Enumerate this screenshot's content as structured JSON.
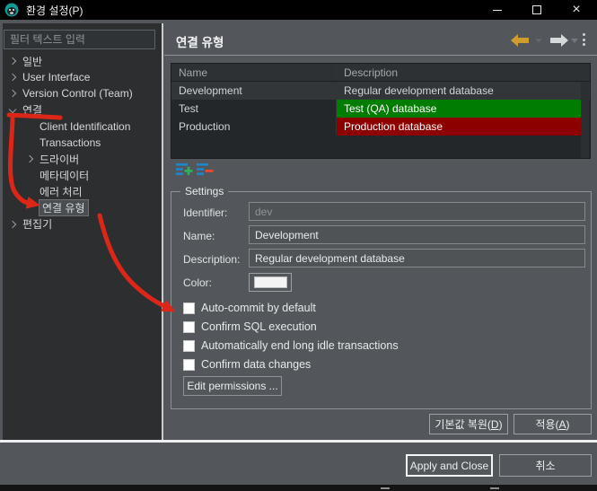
{
  "window": {
    "title": "환경 설정(P)"
  },
  "sidebar": {
    "filter_placeholder": "필터 텍스트 입력",
    "tree": [
      {
        "label": "일반"
      },
      {
        "label": "User Interface"
      },
      {
        "label": "Version Control (Team)"
      },
      {
        "label": "연결"
      },
      {
        "label": "Client Identification"
      },
      {
        "label": "Transactions"
      },
      {
        "label": "드라이버"
      },
      {
        "label": "메타데이터"
      },
      {
        "label": "에러 처리"
      },
      {
        "label": "연결 유형"
      },
      {
        "label": "편집기"
      }
    ]
  },
  "main": {
    "title": "연결 유형",
    "table": {
      "columns": [
        "Name",
        "Description"
      ],
      "rows": [
        {
          "name": "Development",
          "description": "Regular development database",
          "desc_bg": ""
        },
        {
          "name": "Test",
          "description": "Test (QA) database",
          "desc_bg": "#007C00"
        },
        {
          "name": "Production",
          "description": "Production database",
          "desc_bg": "#8D0000"
        }
      ]
    },
    "settings": {
      "legend": "Settings",
      "fields": {
        "identifier_label": "Identifier:",
        "identifier_value": "dev",
        "name_label": "Name:",
        "name_value": "Development",
        "description_label": "Description:",
        "description_value": "Regular development database",
        "color_label": "Color:",
        "color_value": "#F4F4F4"
      },
      "checkboxes": [
        "Auto-commit by default",
        "Confirm SQL execution",
        "Automatically end long idle transactions",
        "Confirm data changes"
      ],
      "edit_permissions_label": "Edit permissions ..."
    },
    "buttons": {
      "restore_pre": "기본값 복원(",
      "restore_key": "D",
      "restore_post": ")",
      "apply_pre": "적용(",
      "apply_key": "A",
      "apply_post": ")"
    }
  },
  "footer": {
    "apply_close": "Apply and Close",
    "cancel": "취소"
  },
  "annotation": {
    "color": "#DC2718"
  }
}
